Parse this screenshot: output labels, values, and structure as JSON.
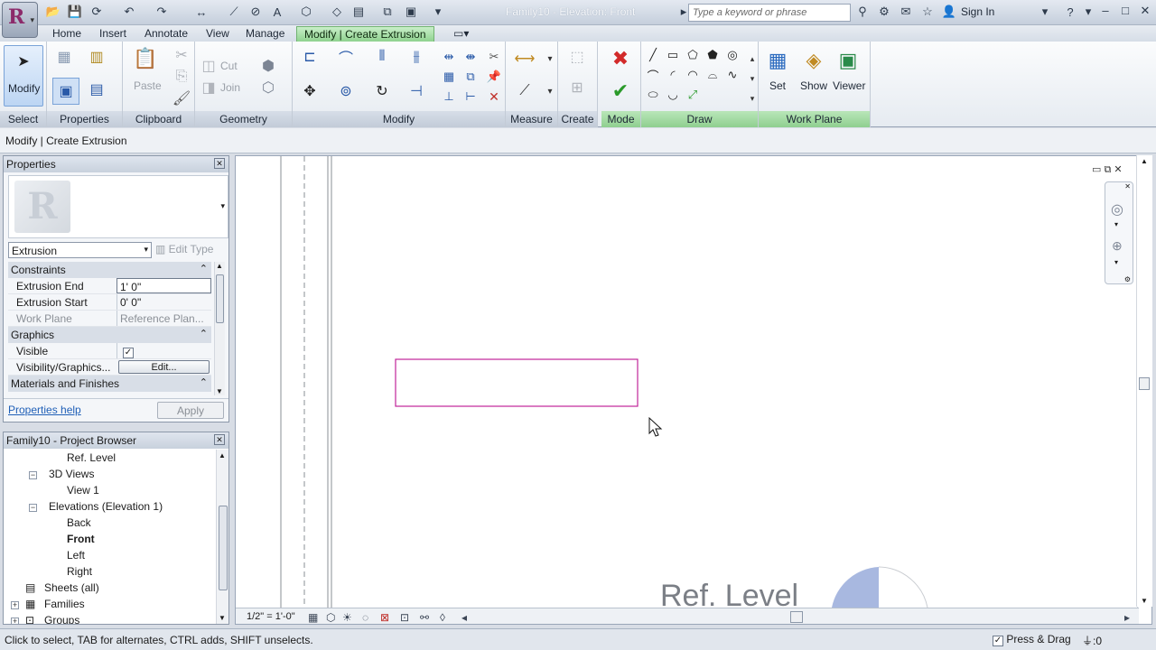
{
  "window": {
    "title": "Family10 - Elevation: Front",
    "search_placeholder": "Type a keyword or phrase",
    "sign_in": "Sign In"
  },
  "ribbon": {
    "tabs": [
      "Home",
      "Insert",
      "Annotate",
      "View",
      "Manage",
      "Modify | Create Extrusion"
    ],
    "active_tab": "Modify | Create Extrusion",
    "accent_color": "#8fd28f",
    "panels": {
      "select": {
        "label": "Select",
        "modify_label": "Modify"
      },
      "properties": {
        "label": "Properties"
      },
      "clipboard": {
        "label": "Clipboard",
        "paste_label": "Paste"
      },
      "geometry": {
        "label": "Geometry",
        "cut_label": "Cut",
        "join_label": "Join"
      },
      "modify": {
        "label": "Modify"
      },
      "measure": {
        "label": "Measure"
      },
      "create": {
        "label": "Create"
      },
      "mode": {
        "label": "Mode"
      },
      "draw": {
        "label": "Draw"
      },
      "work_plane": {
        "label": "Work Plane",
        "set_label": "Set",
        "show_label": "Show",
        "viewer_label": "Viewer"
      }
    }
  },
  "options_bar": {
    "text": "Modify | Create Extrusion"
  },
  "properties": {
    "title": "Properties",
    "type": "Extrusion",
    "edit_type": "Edit Type",
    "categories": [
      {
        "name": "Constraints"
      },
      {
        "name": "Graphics"
      },
      {
        "name": "Materials and Finishes"
      }
    ],
    "rows": {
      "extrusion_end": {
        "label": "Extrusion End",
        "value": "1'  0\""
      },
      "extrusion_start": {
        "label": "Extrusion Start",
        "value": "0'  0\""
      },
      "work_plane": {
        "label": "Work Plane",
        "value": "Reference Plan..."
      },
      "visible": {
        "label": "Visible",
        "checked": true
      },
      "visibility_graphics": {
        "label": "Visibility/Graphics...",
        "button": "Edit..."
      }
    },
    "help_link": "Properties help",
    "apply": "Apply"
  },
  "project_browser": {
    "title": "Family10 - Project Browser",
    "items": [
      "Ref. Level",
      "3D Views",
      "View 1",
      "Elevations (Elevation 1)",
      "Back",
      "Front",
      "Left",
      "Right",
      "Sheets (all)",
      "Families",
      "Groups"
    ],
    "selected": "Front"
  },
  "canvas": {
    "scale": "1/2\" = 1'-0\"",
    "level_label": "Ref. Level",
    "sketch_color": "#c0249a"
  },
  "status_bar": {
    "text": "Click to select, TAB for alternates, CTRL adds, SHIFT unselects.",
    "press_drag": "Press & Drag",
    "filter_count": ":0"
  }
}
